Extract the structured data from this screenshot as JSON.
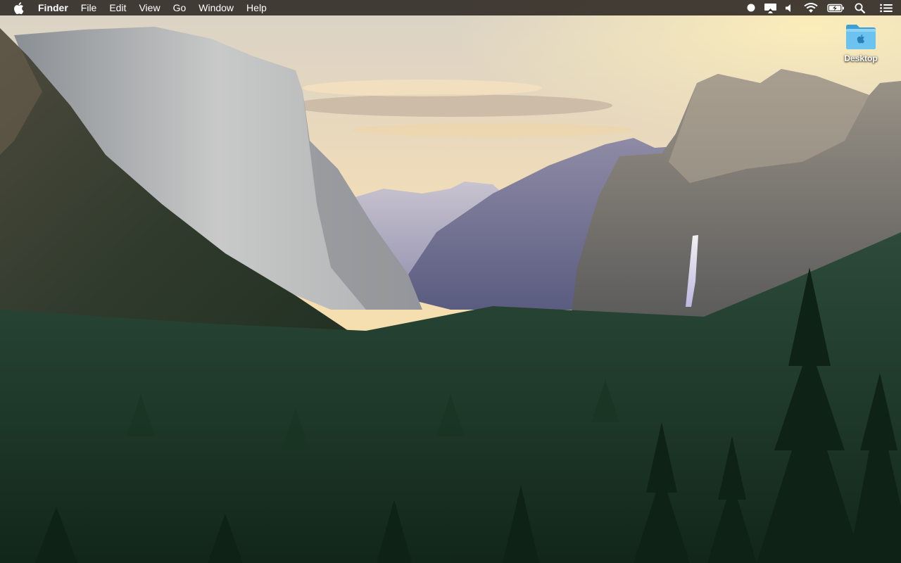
{
  "menubar": {
    "apple_icon": "apple-logo-icon",
    "app_name": "Finder",
    "menus": [
      "File",
      "Edit",
      "View",
      "Go",
      "Window",
      "Help"
    ],
    "status_icons": [
      "record-dot-icon",
      "airplay-display-icon",
      "volume-icon",
      "wifi-icon",
      "battery-charging-icon",
      "spotlight-search-icon",
      "notification-center-icon"
    ]
  },
  "desktop": {
    "icons": [
      {
        "label": "Desktop",
        "icon": "folder-icon"
      }
    ]
  },
  "colors": {
    "menubar_bg": "#342e28",
    "folder_blue": "#5ab4e6"
  }
}
